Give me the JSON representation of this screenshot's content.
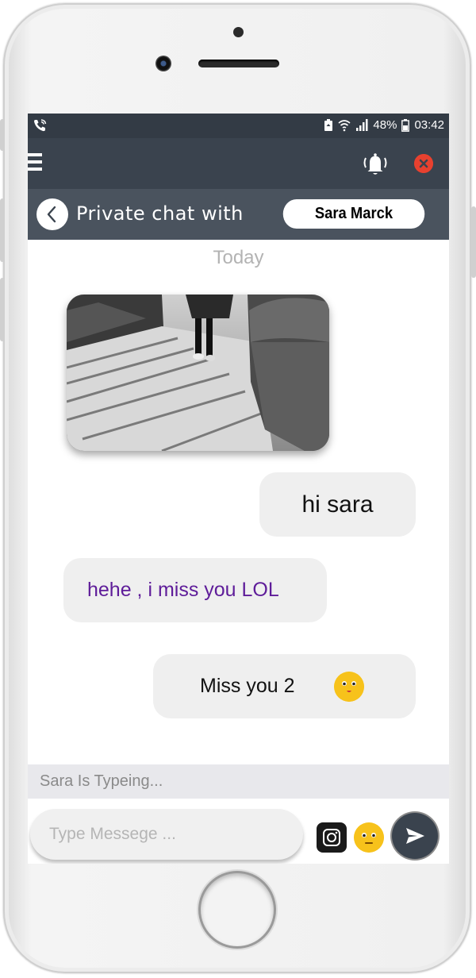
{
  "status_bar": {
    "battery": "48%",
    "time": "03:42"
  },
  "header": {
    "title": "Private chat with",
    "contact_name": "Sara Marck"
  },
  "chat": {
    "day_label": "Today",
    "messages": [
      {
        "text": "hi sara"
      },
      {
        "text": "hehe , i miss you LOL"
      },
      {
        "text": "Miss you 2"
      }
    ]
  },
  "typing_indicator": "Sara Is Typeing...",
  "composer": {
    "placeholder": "Type Messege ..."
  },
  "colors": {
    "header_bg": "#3a434e",
    "status_bg": "#333b45",
    "received_text": "#5e1c99",
    "close_red": "#e8412f",
    "bubble_bg": "#efefef"
  }
}
